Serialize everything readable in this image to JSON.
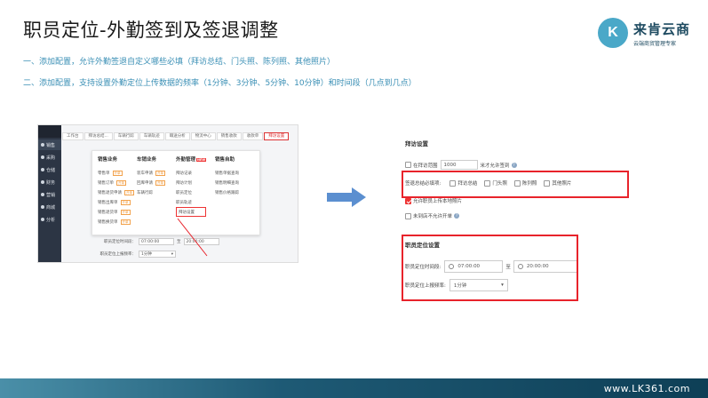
{
  "title": "职员定位-外勤签到及签退调整",
  "logo": {
    "mark": "K",
    "name": "来肯云商",
    "slogan": "云端商贸管理专家"
  },
  "descriptions": [
    "一、添加配置，允许外勤签退自定义哪些必填（拜访总结、门头照、陈列照、其他照片）",
    "二、添加配置，支持设置外勤定位上传数据的频率（1分钟、3分钟、5分钟、10分钟）和时间段（几点到几点）"
  ],
  "screenshot": {
    "sidebar": [
      "销售",
      "采购",
      "仓储",
      "财务",
      "营销",
      "商城",
      "分析"
    ],
    "tabs": [
      "工作台",
      "拜访总结...",
      "车辆行踪",
      "车辆轨迹",
      "職送分析",
      "物流中心",
      "销售收款",
      "收款单",
      "拜访设置"
    ],
    "columns": [
      {
        "header": "销售业务",
        "new": "",
        "items": [
          {
            "label": "零售单",
            "tag": "开单"
          },
          {
            "label": "销售订单",
            "tag": "开单"
          },
          {
            "label": "销售退货申请",
            "tag": "开单"
          },
          {
            "label": "销售出库单",
            "tag": "开单"
          },
          {
            "label": "销售退货单",
            "tag": "开单"
          },
          {
            "label": "销售换货单",
            "tag": "开单"
          }
        ]
      },
      {
        "header": "车销业务",
        "new": "",
        "items": [
          {
            "label": "装车申请",
            "tag": "开单"
          },
          {
            "label": "回库申请",
            "tag": "开单"
          },
          {
            "label": "车辆行踪",
            "tag": ""
          }
        ]
      },
      {
        "header": "外勤管理",
        "new": "NEW",
        "items": [
          {
            "label": "拜访记录",
            "tag": ""
          },
          {
            "label": "拜访计划",
            "tag": ""
          },
          {
            "label": "职员定位",
            "tag": ""
          },
          {
            "label": "职员轨迹",
            "tag": ""
          },
          {
            "label": "拜访设置",
            "tag": ""
          }
        ]
      },
      {
        "header": "销售自助",
        "new": "",
        "items": [
          {
            "label": "销售单据查询",
            "tag": ""
          },
          {
            "label": "销售明细查询",
            "tag": ""
          },
          {
            "label": "销售价格跟踪",
            "tag": ""
          }
        ]
      }
    ],
    "form": {
      "time_label": "职员定位时间段：",
      "time_from": "07:00:00",
      "time_sep": "至",
      "time_to": "20:00:00",
      "freq_label": "职员定位上报频率：",
      "freq_value": "1分钟"
    }
  },
  "panel": {
    "visit_title": "拜访设置",
    "range_label": "在拜访范围",
    "range_value": "1000",
    "range_suffix": "米才允许签到",
    "required_label": "签退总结必填项:",
    "required_options": [
      "拜访总结",
      "门头照",
      "陈列照",
      "其他照片"
    ],
    "upload_label": "允许职员上传本地照片",
    "no_signout_label": "未到店不允许开单",
    "locate_title": "职员定位设置",
    "time_label": "职员定位时间段:",
    "time_from": "07:00:00",
    "time_sep": "至",
    "time_to": "20:00:00",
    "freq_label": "职员定位上报频率:",
    "freq_value": "1分钟"
  },
  "footer": {
    "url": "www.LK361.com"
  },
  "colors": {
    "accent": "#3a8fb5",
    "highlight": "#e8232b",
    "arrow": "#5b8fd0"
  }
}
